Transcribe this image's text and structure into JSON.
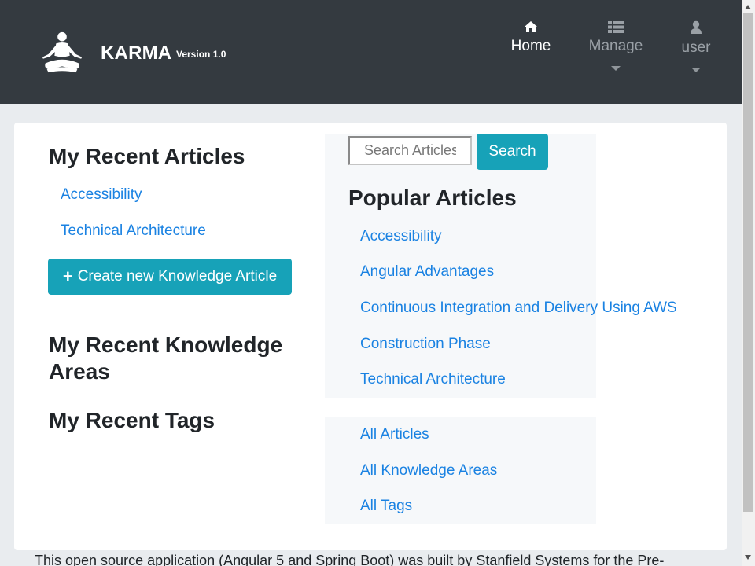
{
  "navbar": {
    "brand": "KARMA",
    "version": "Version 1.0",
    "items": [
      {
        "label": "Home",
        "icon": "home-icon"
      },
      {
        "label": "Manage",
        "icon": "list-icon"
      },
      {
        "label": "user",
        "icon": "user-icon"
      }
    ]
  },
  "recent_articles": {
    "title": "My Recent Articles",
    "items": [
      "Accessibility",
      "Technical Architecture"
    ]
  },
  "create_button": {
    "label": "Create new Knowledge Article"
  },
  "recent_knowledge_areas": {
    "title": "My Recent Knowledge Areas"
  },
  "recent_tags": {
    "title": "My Recent Tags"
  },
  "search": {
    "placeholder": "Search Articles",
    "button_label": "Search"
  },
  "popular_articles": {
    "title": "Popular Articles",
    "items": [
      "Accessibility",
      "Angular Advantages",
      "Continuous Integration and Delivery Using AWS",
      "Construction Phase",
      "Technical Architecture"
    ]
  },
  "all_links": [
    "All Articles",
    "All Knowledge Areas",
    "All Tags"
  ],
  "footer": {
    "text": "This open source application (Angular 5 and Spring Boot) was built by Stanfield Systems for the Pre-"
  },
  "colors": {
    "navbar": "#343a40",
    "accent": "#17a2b8",
    "link": "#1a82e2"
  }
}
